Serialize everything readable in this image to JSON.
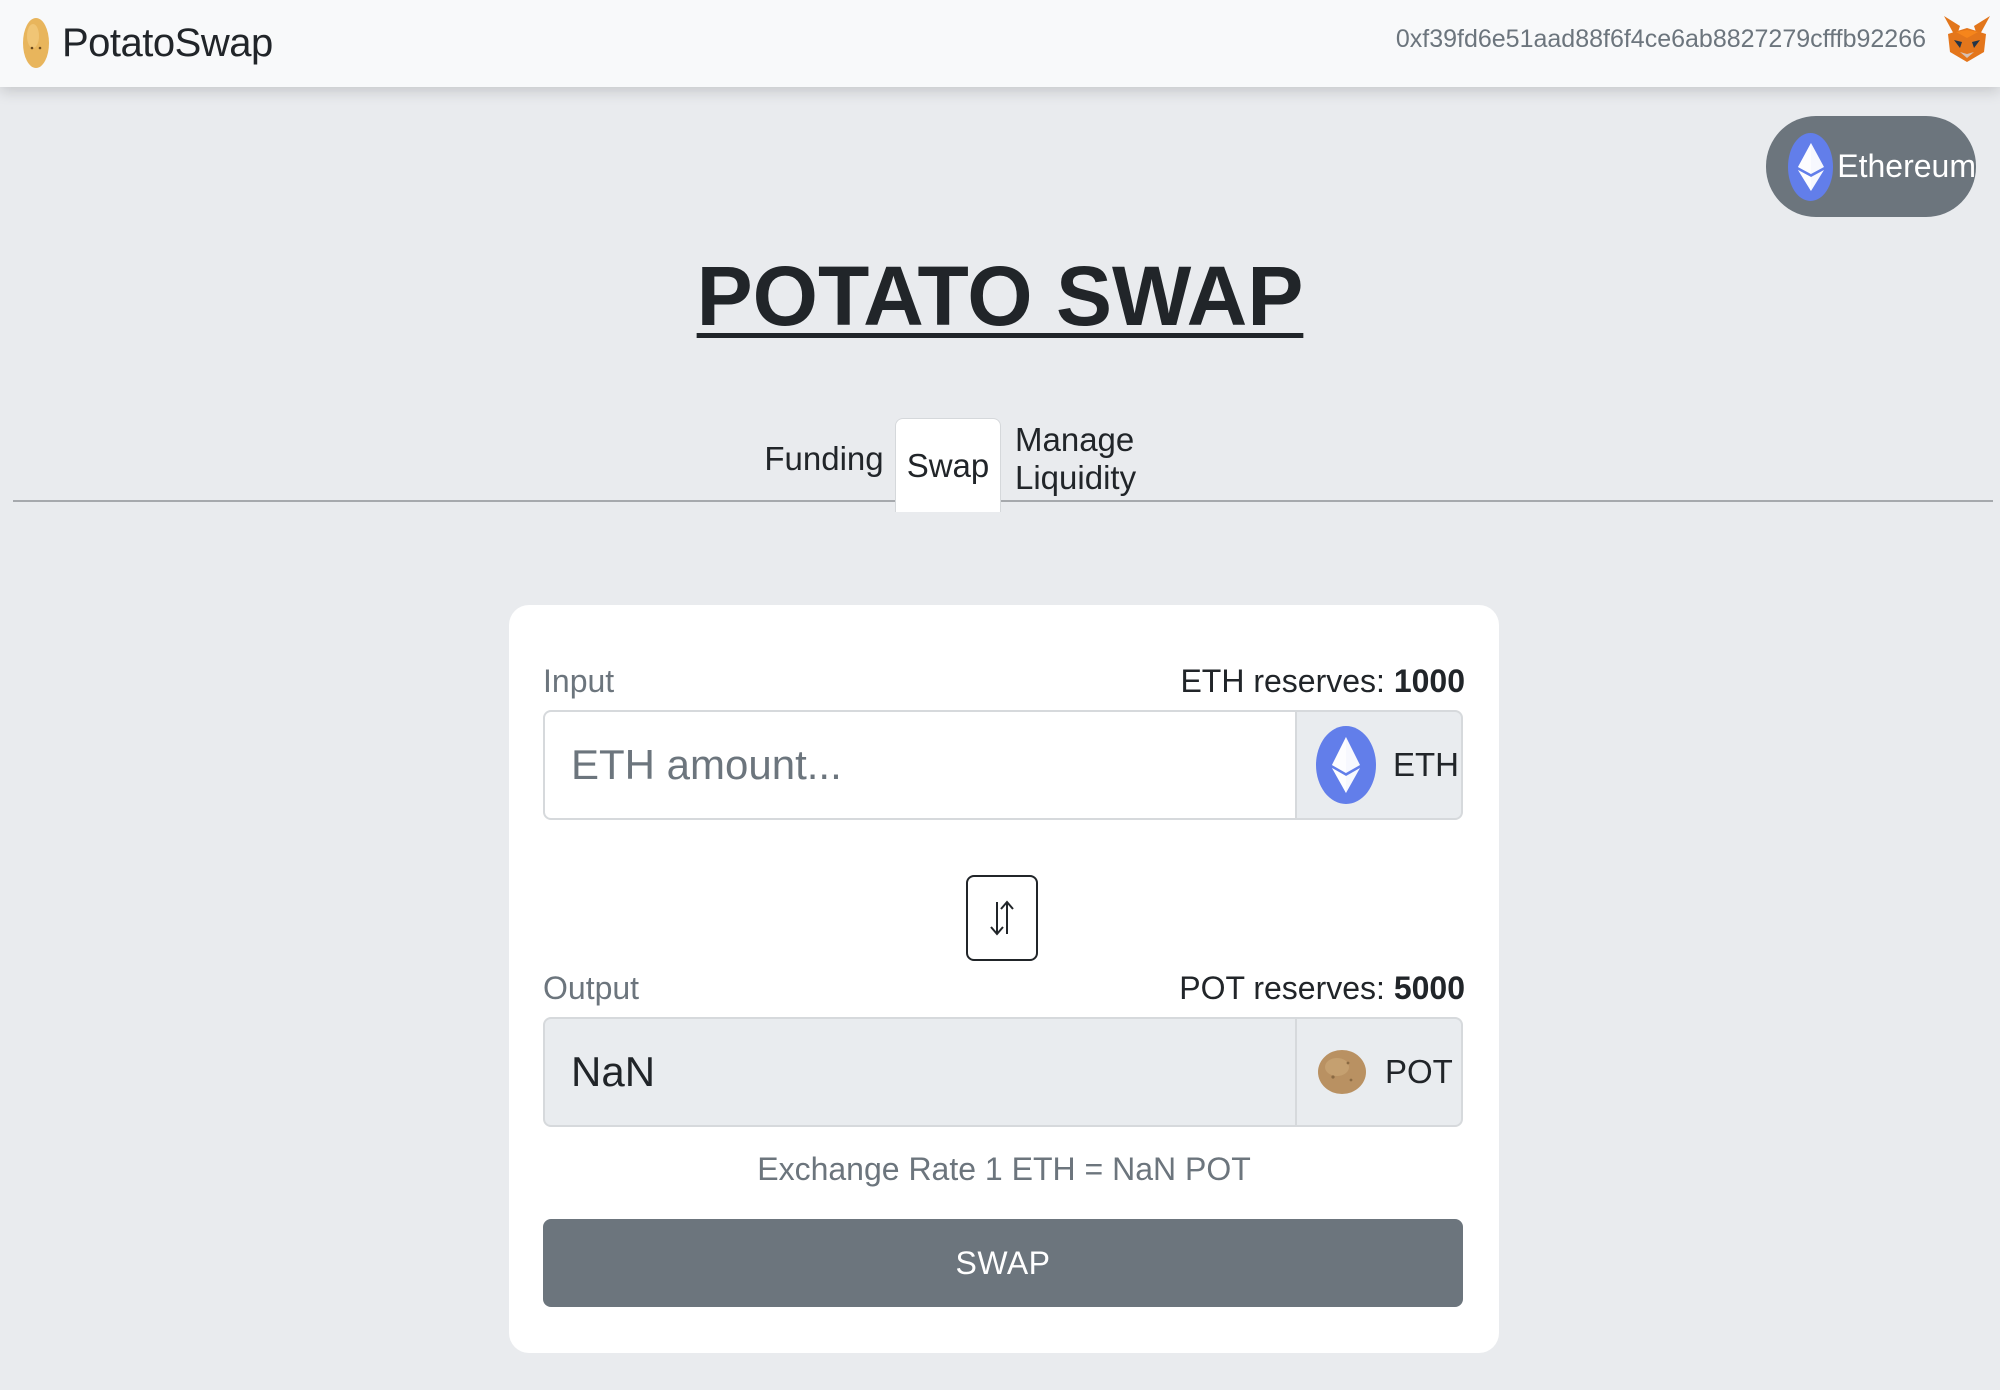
{
  "navbar": {
    "brand": "PotatoSwap",
    "wallet_address": "0xf39fd6e51aad88f6f4ce6ab8827279cfffb92266"
  },
  "network": {
    "label": "Ethereum"
  },
  "page_title": "POTATO SWAP",
  "tabs": [
    {
      "label": "Funding",
      "active": false
    },
    {
      "label": "Swap",
      "active": true
    },
    {
      "label": "Manage Liquidity",
      "active": false
    }
  ],
  "swap": {
    "input": {
      "label": "Input",
      "reserves_label": "ETH reserves:",
      "reserves_value": "1000",
      "placeholder": "ETH amount...",
      "value": "",
      "token": "ETH",
      "token_icon": "ethereum-icon"
    },
    "switch_icon": "swap-arrows-icon",
    "output": {
      "label": "Output",
      "reserves_label": "POT reserves:",
      "reserves_value": "5000",
      "value": "NaN",
      "token": "POT",
      "token_icon": "potato-icon"
    },
    "exchange_rate": "Exchange Rate 1 ETH = NaN POT",
    "button_label": "SWAP"
  },
  "colors": {
    "background": "#e9ebee",
    "navbar": "#f8f9fa",
    "secondary": "#6c757d",
    "ethereum": "#627eea",
    "potato": "#c9a46a"
  }
}
